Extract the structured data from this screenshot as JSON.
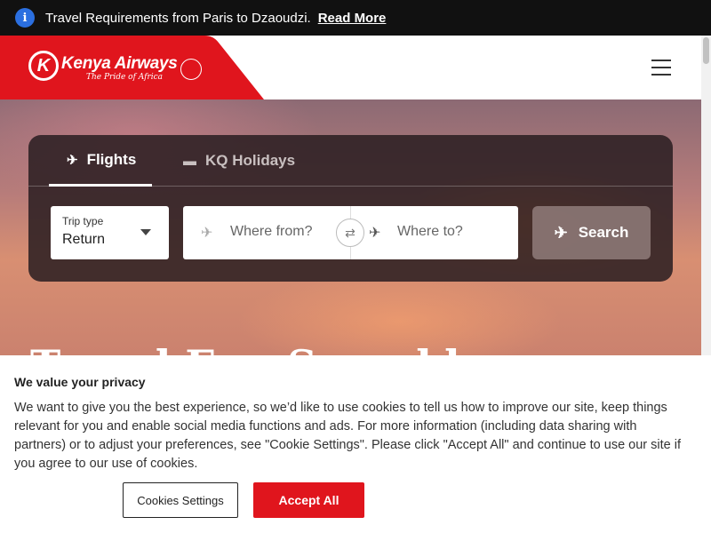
{
  "info_bar": {
    "icon": "info-icon",
    "message": "Travel Requirements from Paris to Dzaoudzi.",
    "link": "Read More"
  },
  "header": {
    "logo_mark": "K",
    "logo_name": "Kenya Airways",
    "logo_tagline": "The Pride of Africa",
    "brand_color": "#e0151d",
    "menu_icon": "hamburger-menu-icon"
  },
  "hero": {
    "headline": "Travel Fun Sumakk"
  },
  "booking": {
    "tabs": [
      {
        "label": "Flights",
        "icon": "airplane-icon",
        "active": true
      },
      {
        "label": "KQ Holidays",
        "icon": "bed-icon",
        "active": false
      }
    ],
    "trip_type": {
      "label": "Trip type",
      "value": "Return"
    },
    "from": {
      "placeholder": "Where from?",
      "icon": "plane-departure-icon"
    },
    "to": {
      "placeholder": "Where to?",
      "icon": "plane-arrival-icon"
    },
    "swap_icon": "swap-arrows-icon",
    "search": {
      "label": "Search",
      "icon": "plane-takeoff-icon"
    }
  },
  "cookie_banner": {
    "title": "We value your privacy",
    "text": "We want to give you the best experience, so we’d like to use cookies to tell us how to improve our site, keep things relevant for you and enable social media functions and ads. For more information (including data sharing with partners) or to adjust your preferences, see \"Cookie Settings\". Please click \"Accept All\" and continue to use our site if you agree to our use of cookies.",
    "settings_button": "Cookies Settings",
    "accept_button": "Accept All"
  }
}
